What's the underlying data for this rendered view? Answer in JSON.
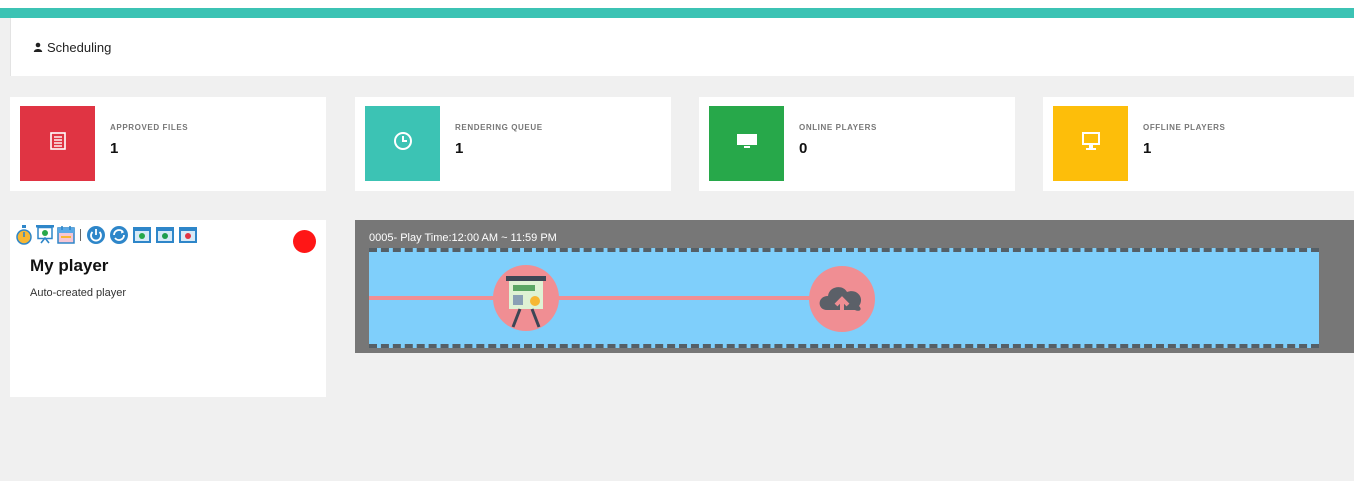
{
  "header": {
    "title": "Scheduling",
    "icon": "user-icon"
  },
  "stats": [
    {
      "label": "APPROVED FILES",
      "value": "1",
      "color": "#e03443",
      "icon": "document-icon"
    },
    {
      "label": "RENDERING QUEUE",
      "value": "1",
      "color": "#3cc3b4",
      "icon": "clock-icon"
    },
    {
      "label": "ONLINE PLAYERS",
      "value": "0",
      "color": "#27a84a",
      "icon": "monitor-icon"
    },
    {
      "label": "OFFLINE PLAYERS",
      "value": "1",
      "color": "#fdbe0a",
      "icon": "monitor-off-icon"
    }
  ],
  "player": {
    "name": "My player",
    "description": "Auto-created player",
    "status_color": "#ff1616",
    "action_icons": [
      "stopwatch-icon",
      "presentation-icon",
      "calendar-icon",
      "power-icon",
      "refresh-icon",
      "screen-green-icon",
      "screen-green-alt-icon",
      "screen-red-icon"
    ]
  },
  "timeline": {
    "title": "0005- Play Time:12:00 AM ~ 11:59 PM",
    "items": [
      "presentation-icon",
      "cloud-upload-icon"
    ]
  }
}
